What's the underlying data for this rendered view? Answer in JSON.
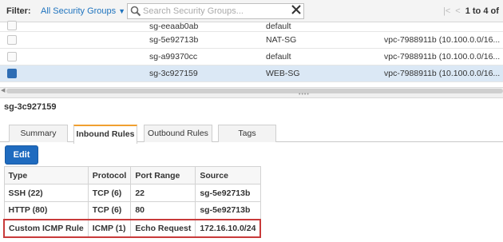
{
  "filterbar": {
    "label": "Filter:",
    "select_value": "All Security Groups",
    "search_placeholder": "Search Security Groups...",
    "pager_text": "1 to 4 of"
  },
  "groups": [
    {
      "id": "sg-eeaab0ab",
      "name": "default",
      "vpc": "",
      "selected": false
    },
    {
      "id": "sg-5e92713b",
      "name": "NAT-SG",
      "vpc": "vpc-7988911b (10.100.0.0/16...",
      "selected": false
    },
    {
      "id": "sg-a99370cc",
      "name": "default",
      "vpc": "vpc-7988911b (10.100.0.0/16...",
      "selected": false
    },
    {
      "id": "sg-3c927159",
      "name": "WEB-SG",
      "vpc": "vpc-7988911b (10.100.0.0/16...",
      "selected": true
    }
  ],
  "detail": {
    "title": "sg-3c927159",
    "tabs": [
      "Summary",
      "Inbound Rules",
      "Outbound Rules",
      "Tags"
    ],
    "active_tab": "Inbound Rules",
    "edit_label": "Edit"
  },
  "rules_table": {
    "headers": [
      "Type",
      "Protocol",
      "Port Range",
      "Source"
    ],
    "rows": [
      [
        "SSH (22)",
        "TCP (6)",
        "22",
        "sg-5e92713b"
      ],
      [
        "HTTP (80)",
        "TCP (6)",
        "80",
        "sg-5e92713b"
      ],
      [
        "Custom ICMP Rule",
        "ICMP (1)",
        "Echo Request",
        "172.16.10.0/24"
      ]
    ],
    "highlighted_row": 2,
    "highlight_color": "#c83a3a"
  },
  "colors": {
    "link": "#1e73be",
    "button": "#1f6bbf",
    "selected_row": "#dbe8f5",
    "active_tab_accent": "#f0a030"
  }
}
